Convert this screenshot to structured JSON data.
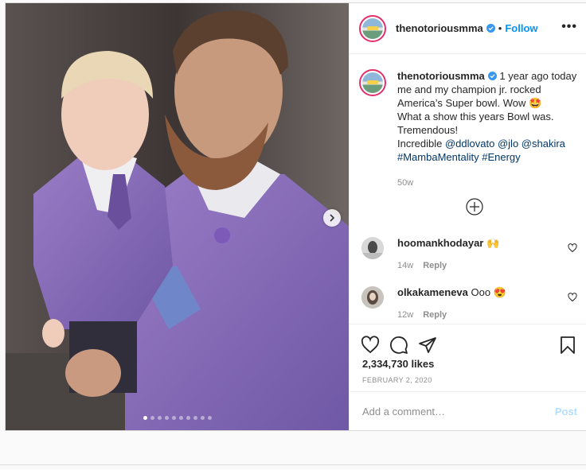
{
  "post": {
    "username": "thenotoriousmma",
    "follow_label": "Follow",
    "separator": "•",
    "more_label": "•••"
  },
  "caption": {
    "username": "thenotoriousmma",
    "line1": " 1 year ago today me and my champion jr. rocked America’s Super bowl. Wow 🤩",
    "line2": "What a show this years Bowl was. Tremendous!",
    "line3_prefix": "Incredible ",
    "mention1": "@ddlovato",
    "mention2": "@jlo",
    "mention3": "@shakira",
    "hashtag1": "#MambaMentality",
    "hashtag2": "#Energy",
    "time": "50w"
  },
  "comments": [
    {
      "username": "hoomankhodayar",
      "text": " 🙌",
      "time": "14w",
      "reply_label": "Reply"
    },
    {
      "username": "olkakameneva",
      "text": " Ooo 😍",
      "time": "12w",
      "reply_label": "Reply"
    }
  ],
  "likes_text": "2,334,730 likes",
  "date": "FEBRUARY 2, 2020",
  "add_comment": {
    "placeholder": "Add a comment…",
    "post_label": "Post"
  },
  "carousel": {
    "total": 10,
    "active": 1
  },
  "colors": {
    "link": "#00376b",
    "follow": "#0095f6",
    "post_disabled": "#b2dffc"
  },
  "icons": [
    "verified-badge-icon",
    "chevron-right-icon",
    "add-circle-icon",
    "heart-icon",
    "comment-icon",
    "share-icon",
    "bookmark-icon"
  ]
}
